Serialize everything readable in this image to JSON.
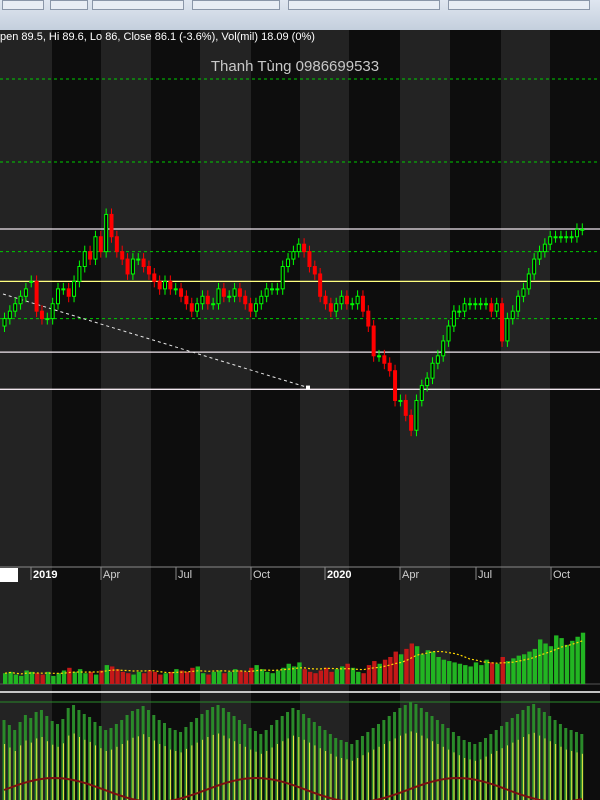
{
  "header": {
    "ohlc_text": "pen 89.5, Hi 89.6, Lo 86, Close 86.1 (-3.6%), Vol(mil) 18.09 (0%)",
    "watermark": "Thanh Tùng 0986699533"
  },
  "colors": {
    "up": "#00ff00",
    "down": "#ff0000",
    "up_vol": "#22b522",
    "down_vol": "#c41818",
    "hline_yellow": "#ffff80",
    "hline_white": "#f0e6ee",
    "grid_green": "#00cc00"
  },
  "chart_data": [
    {
      "type": "candlestick",
      "title": "",
      "x_tick_labels": [
        "2019",
        "Apr",
        "Jul",
        "Oct",
        "2020",
        "Apr",
        "Jul",
        "Oct"
      ],
      "ylim": [
        70,
        113
      ],
      "horizontal_lines": {
        "white": [
          104,
          84.5,
          79.5
        ],
        "yellow": [
          94
        ],
        "green_dashed": [
          123,
          113,
          98,
          89
        ]
      },
      "trendline": {
        "from": [
          0,
          103
        ],
        "to": [
          122,
          80
        ]
      },
      "series": [
        {
          "o": [
            88,
            89,
            90,
            91,
            92,
            94,
            94,
            90,
            89,
            89,
            91,
            93,
            93,
            92,
            94,
            96,
            98,
            97,
            100,
            98,
            103,
            100,
            98,
            97,
            95,
            97,
            97,
            96,
            95,
            94,
            93,
            94,
            93,
            93,
            92,
            91,
            90,
            91,
            92,
            91,
            91,
            93,
            92,
            92,
            93,
            92,
            91,
            90,
            91,
            92,
            93,
            93,
            93,
            96,
            97,
            98,
            99,
            98,
            96,
            95,
            92,
            91,
            90,
            91,
            92,
            91,
            91,
            92,
            90,
            88,
            84,
            84,
            83,
            82,
            78,
            78,
            76,
            74,
            78,
            80,
            81,
            83,
            84,
            86,
            88,
            90,
            90,
            91,
            91,
            91,
            91,
            91,
            90,
            91,
            86,
            89,
            90,
            92,
            93,
            95,
            97,
            98,
            99,
            100,
            100,
            100,
            100,
            100,
            101
          ],
          "c": [
            89,
            90,
            91,
            92,
            93,
            94,
            90,
            89,
            89,
            91,
            93,
            93,
            92,
            94,
            96,
            98,
            97,
            100,
            98,
            103,
            100,
            98,
            97,
            95,
            97,
            97,
            96,
            95,
            94,
            93,
            94,
            93,
            93,
            92,
            91,
            90,
            91,
            92,
            91,
            91,
            93,
            92,
            92,
            93,
            92,
            91,
            90,
            91,
            92,
            93,
            93,
            93,
            96,
            97,
            98,
            99,
            98,
            96,
            95,
            92,
            91,
            90,
            91,
            92,
            91,
            91,
            92,
            90,
            88,
            84,
            84,
            83,
            82,
            78,
            78,
            76,
            74,
            78,
            80,
            81,
            83,
            84,
            86,
            88,
            90,
            90,
            91,
            91,
            91,
            91,
            91,
            90,
            91,
            86,
            89,
            90,
            92,
            93,
            95,
            97,
            98,
            99,
            100,
            100,
            100,
            100,
            100,
            101,
            101
          ]
        }
      ]
    },
    {
      "type": "bar",
      "title": "",
      "series": [
        {
          "name": "",
          "values": [
            8,
            9,
            7,
            6,
            10,
            9,
            8,
            7,
            9,
            6,
            8,
            10,
            12,
            9,
            11,
            8,
            9,
            7,
            10,
            14,
            13,
            11,
            9,
            8,
            7,
            9,
            8,
            10,
            9,
            7,
            8,
            9,
            11,
            10,
            9,
            12,
            13,
            8,
            7,
            9,
            10,
            8,
            9,
            11,
            10,
            9,
            12,
            14,
            11,
            9,
            8,
            10,
            12,
            15,
            13,
            16,
            11,
            9,
            8,
            10,
            12,
            9,
            11,
            13,
            15,
            12,
            9,
            8,
            14,
            17,
            15,
            18,
            20,
            24,
            22,
            26,
            30,
            28,
            22,
            25,
            24,
            20,
            18,
            17,
            16,
            15,
            14,
            13,
            16,
            14,
            18,
            16,
            15,
            20,
            17,
            19,
            21,
            22,
            24,
            26,
            33,
            30,
            28,
            36,
            34,
            29,
            32,
            35,
            38
          ]
        }
      ]
    },
    {
      "type": "bar",
      "title": "",
      "series": [
        {
          "name": "",
          "values": [
            80,
            75,
            70,
            78,
            85,
            82,
            88,
            90,
            84,
            79,
            76,
            81,
            92,
            95,
            90,
            86,
            83,
            78,
            74,
            70,
            72,
            76,
            80,
            85,
            89,
            91,
            94,
            90,
            85,
            80,
            77,
            72,
            70,
            68,
            73,
            78,
            82,
            86,
            90,
            93,
            95,
            92,
            88,
            84,
            80,
            76,
            72,
            69,
            66,
            70,
            75,
            80,
            84,
            88,
            92,
            90,
            86,
            82,
            78,
            74,
            70,
            66,
            62,
            60,
            58,
            56,
            60,
            64,
            68,
            72,
            76,
            80,
            84,
            88,
            92,
            95,
            98,
            96,
            92,
            88,
            84,
            80,
            76,
            72,
            68,
            64,
            60,
            58,
            56,
            58,
            62,
            66,
            70,
            74,
            78,
            82,
            86,
            90,
            94,
            96,
            92,
            88,
            84,
            80,
            76,
            72,
            70,
            68,
            66
          ]
        }
      ]
    }
  ]
}
